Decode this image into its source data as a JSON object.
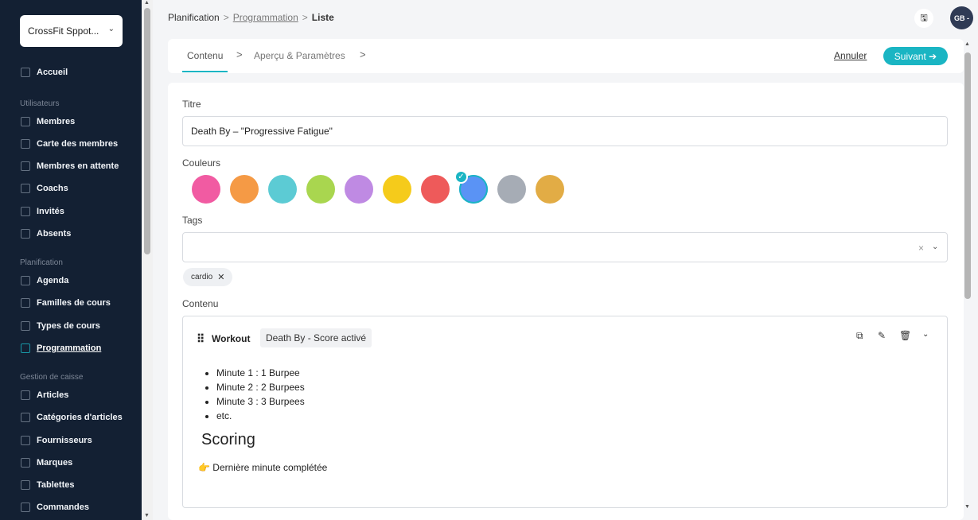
{
  "sidebar": {
    "club": "CrossFit Sppot...",
    "home": "Accueil",
    "sections": {
      "users": "Utilisateurs",
      "planning": "Planification",
      "cash": "Gestion de caisse"
    },
    "items": {
      "members": "Membres",
      "member_map": "Carte des membres",
      "pending": "Membres en attente",
      "coachs": "Coachs",
      "guests": "Invités",
      "absents": "Absents",
      "agenda": "Agenda",
      "families": "Familles de cours",
      "types": "Types de cours",
      "programming": "Programmation",
      "articles": "Articles",
      "categories": "Catégories d'articles",
      "suppliers": "Fournisseurs",
      "brands": "Marques",
      "tablets": "Tablettes",
      "orders": "Commandes"
    }
  },
  "breadcrumb": {
    "root": "Planification",
    "section": "Programmation",
    "current": "Liste",
    "separator": ">"
  },
  "user": {
    "initials": "GB -"
  },
  "steps": {
    "content": "Contenu",
    "preview": "Aperçu & Paramètres",
    "arrow": ">",
    "cancel": "Annuler",
    "next": "Suivant ➔"
  },
  "form": {
    "title_label": "Titre",
    "title_value": "Death By – \"Progressive Fatigue\"",
    "colors_label": "Couleurs",
    "colors": [
      "#f15ba2",
      "#f59a45",
      "#5ccbd4",
      "#a9d64f",
      "#bf8ae3",
      "#f5cb1b",
      "#ee5a5a",
      "#5a93f5",
      "#a6acb5",
      "#e2ac45"
    ],
    "selected_color": "#5a93f5",
    "tags_label": "Tags",
    "tag_chip": "cardio",
    "content_label": "Contenu"
  },
  "workout": {
    "label": "Workout",
    "badge": "Death By  - Score activé",
    "lines": [
      "Minute 1 : 1 Burpee",
      "Minute 2 : 2 Burpees",
      "Minute 3 : 3 Burpees",
      "etc."
    ],
    "scoring_heading": "Scoring",
    "result": "👉 Dernière minute complétée"
  }
}
